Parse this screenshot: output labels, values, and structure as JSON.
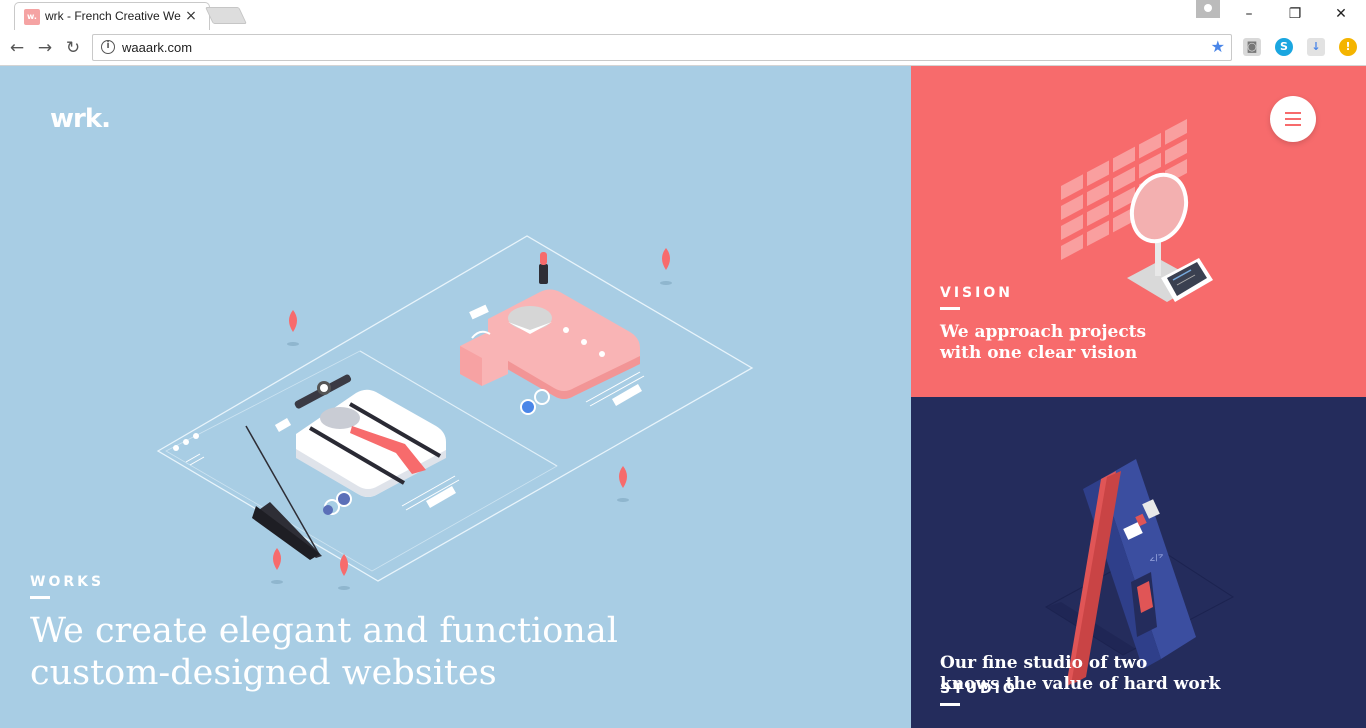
{
  "browser": {
    "tab_title": "wrk - French Creative We",
    "tab_favicon": "w.",
    "url": "waaark.com",
    "window_controls": {
      "minimize": "–",
      "restore": "❐",
      "close": "✕"
    }
  },
  "site": {
    "logo": "wrk.",
    "works": {
      "label": "WORKS",
      "headline_line1": "We create elegant and functional",
      "headline_line2": "custom-designed websites"
    },
    "vision": {
      "label": "VISION",
      "headline_line1": "We approach projects",
      "headline_line2": "with one clear vision"
    },
    "studio": {
      "label": "STUDIO",
      "headline_line1": "Our fine studio of two",
      "headline_line2": "knows the value of hard work"
    }
  },
  "colors": {
    "works_bg": "#a8cde4",
    "vision_bg": "#f76b6c",
    "studio_bg": "#242c5c",
    "text": "#ffffff"
  },
  "icons": {
    "back": "arrow-left-icon",
    "forward": "arrow-right-icon",
    "reload": "reload-icon",
    "info": "info-icon",
    "bookmark": "star-icon",
    "menu": "hamburger-icon"
  }
}
